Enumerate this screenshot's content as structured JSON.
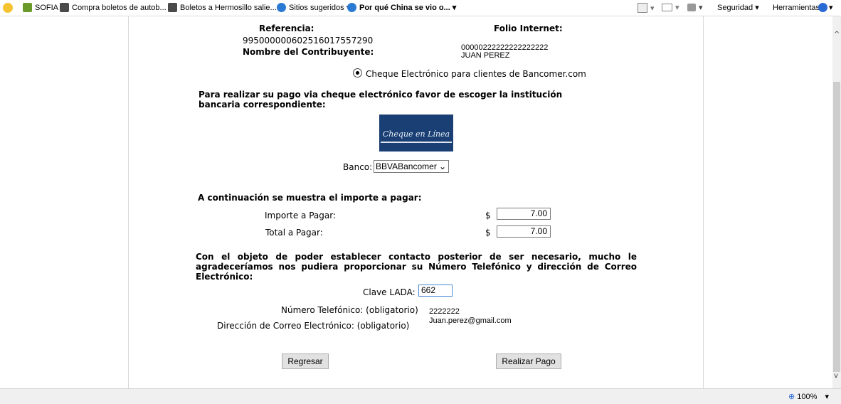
{
  "favorites": [
    {
      "label": "SOFIA",
      "icon": "sofia-icon"
    },
    {
      "label": "Compra boletos de autob...",
      "icon": "bus-icon"
    },
    {
      "label": "Boletos a Hermosillo salie...",
      "icon": "bus-icon"
    },
    {
      "label": "Sitios sugeridos ▾",
      "icon": "ie-icon"
    },
    {
      "label": "Por qué China se vio o... ▾",
      "icon": "ie-icon"
    }
  ],
  "toolbar": {
    "seguridad": "Seguridad ▾",
    "herramientas": "Herramientas ▾"
  },
  "form": {
    "referencia_label": "Referencia:",
    "referencia_value": "99500000060251601755729​0",
    "folio_label": "Folio Internet:",
    "folio_value": "00000222222222222222",
    "contribuyente_label": "Nombre del Contribuyente:",
    "contribuyente_value": "JUAN PEREZ",
    "cheque_option": "Cheque Electrónico para clientes de Bancomer.com",
    "instruction": "Para realizar su pago via cheque electrónico favor de escoger la institución bancaria correspondiente:",
    "logo_text": "Cheque en Línea",
    "banco_label": "Banco:",
    "banco_selected": "BBVABancomer",
    "importe_heading": "A continuación se muestra el importe a pagar:",
    "importe_label": "Importe a Pagar:",
    "importe_currency": "$",
    "importe_value": "7.00",
    "total_label": "Total a Pagar:",
    "total_currency": "$",
    "total_value": "7.00",
    "contact_text": "Con el objeto de poder establecer contacto posterior de ser necesario, mucho le agradeceríamos nos pudiera proporcionar su Número Telefónico y dirección de Correo Electrónico:",
    "lada_label": "Clave LADA:",
    "lada_value": "662",
    "telefono_label": "Número Telefónico: (obligatorio)",
    "telefono_value": "2222222",
    "correo_label": "Dirección de Correo Electrónico: (obligatorio)",
    "correo_value": "Juan.perez@gmail.com",
    "regresar": "Regresar",
    "realizar_pago": "Realizar Pago"
  },
  "status": {
    "zoom": "100%"
  }
}
